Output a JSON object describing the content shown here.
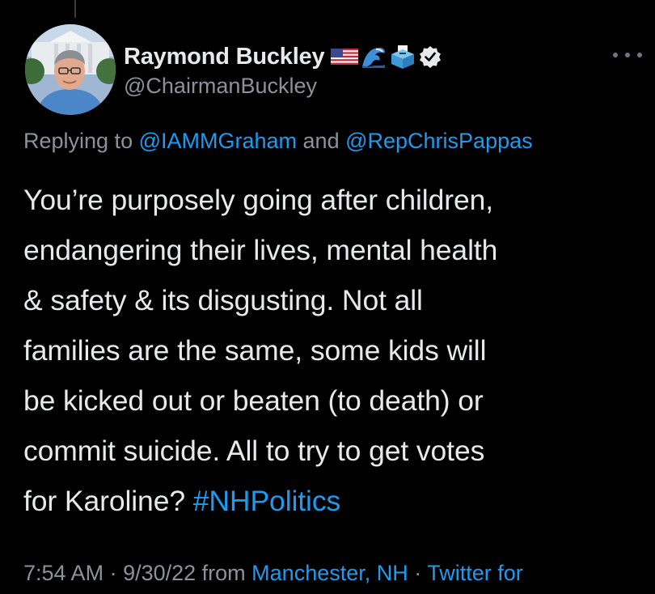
{
  "tweet": {
    "author": {
      "display_name": "Raymond Buckley",
      "handle": "@ChairmanBuckley",
      "name_emojis": [
        "us-flag-icon",
        "water-wave-icon",
        "ballot-box-icon",
        "verified-badge-icon"
      ]
    },
    "reply": {
      "prefix": "Replying to ",
      "mention_1": "@IAMMGraham",
      "connector": " and ",
      "mention_2": "@RepChrisPappas"
    },
    "body": {
      "text": "You’re purposely going after children,\nendangering their lives, mental health\n& safety &  its disgusting. Not all\nfamilies are the same, some kids will\nbe kicked out or beaten (to death) or\ncommit suicide. All to try to get votes\nfor Karoline? ",
      "hashtag": "#NHPolitics"
    },
    "meta": {
      "time": "7:54 AM",
      "separator_1": " · ",
      "date": "9/30/22",
      "from_text": " from ",
      "location": "Manchester, NH",
      "separator_2": " · ",
      "source": "Twitter for"
    }
  },
  "colors": {
    "background": "#000000",
    "text_primary": "#e7e9ea",
    "text_secondary": "#8b9298",
    "accent_blue": "#1d9bf0"
  }
}
